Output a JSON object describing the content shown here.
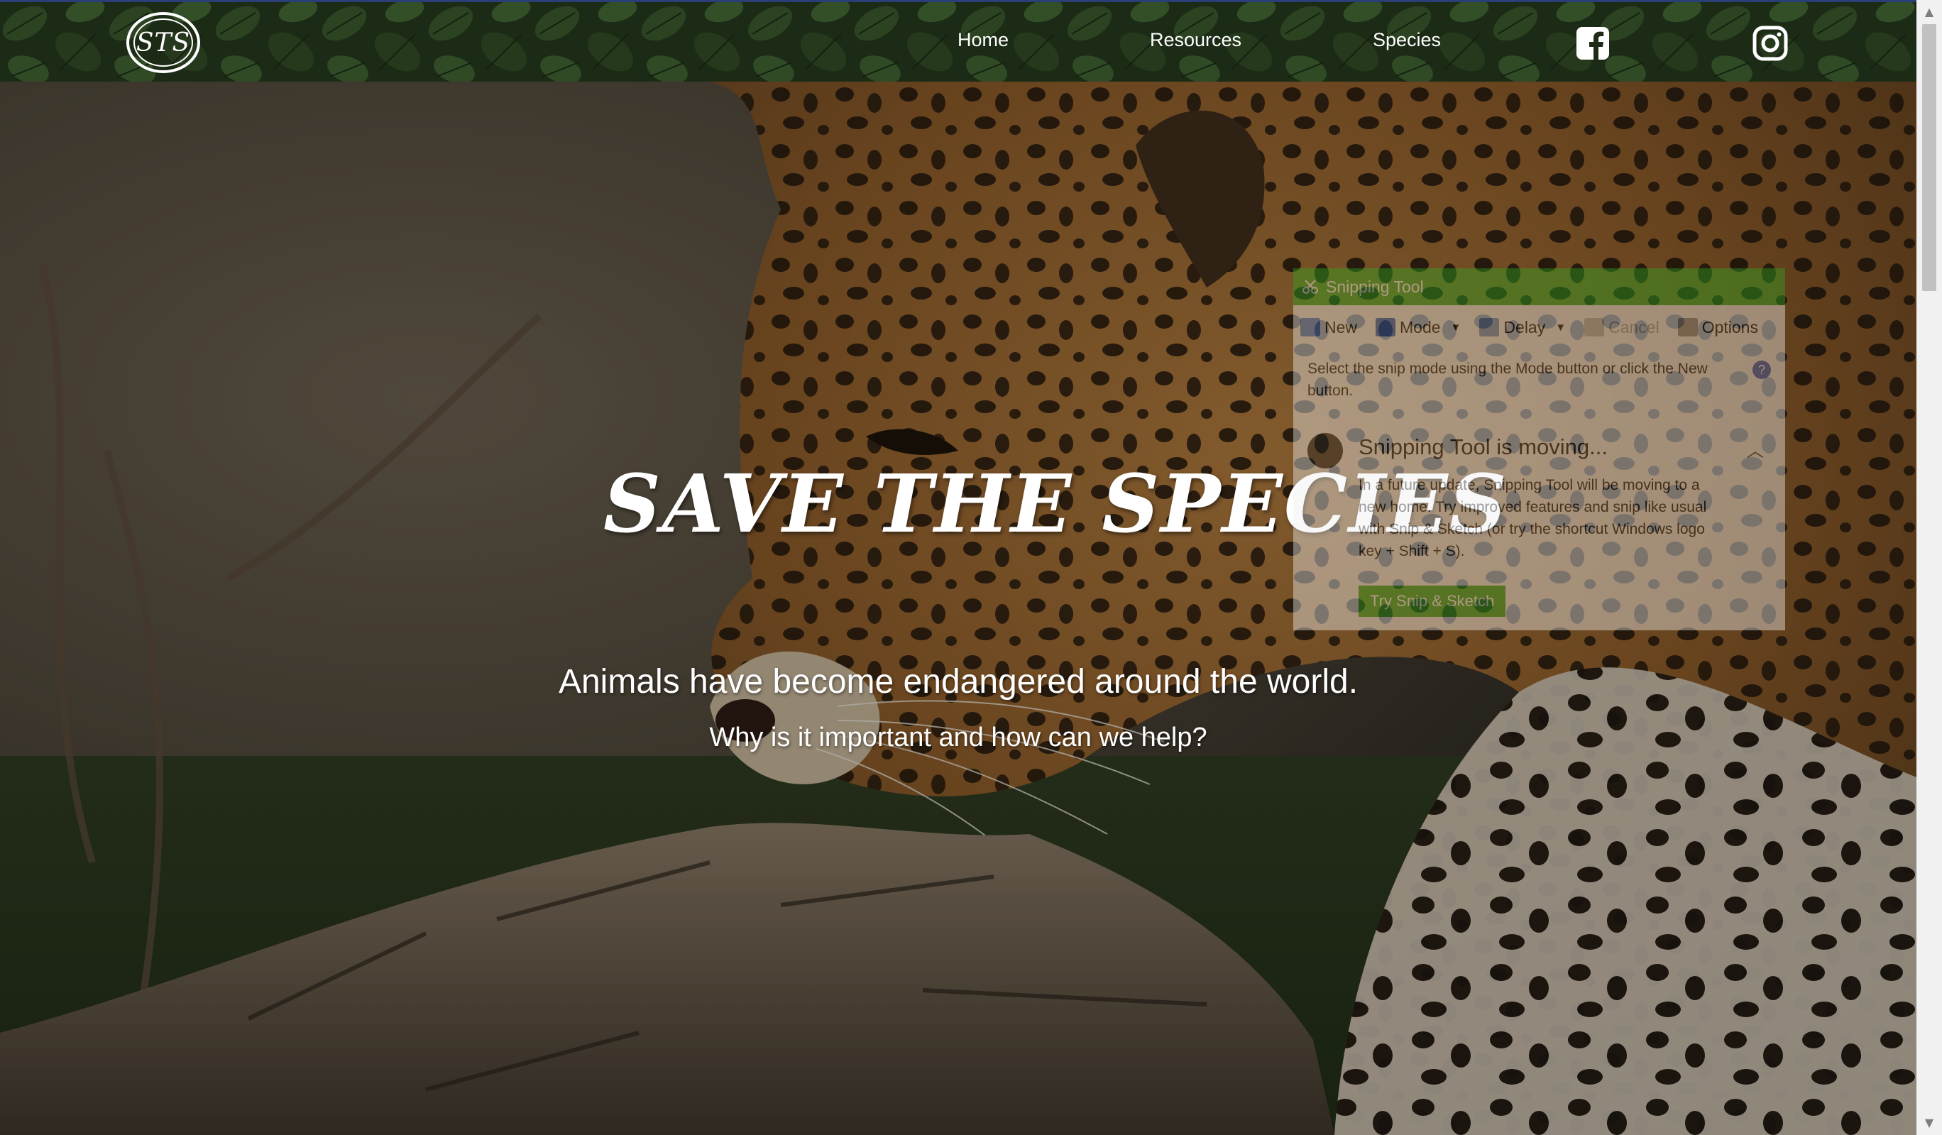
{
  "nav": {
    "logo_text": "STS",
    "links": [
      "Home",
      "Resources",
      "Species"
    ],
    "social": [
      "facebook-icon",
      "instagram-icon"
    ]
  },
  "hero": {
    "title": "SAVE THE SPECIES",
    "subtitle": "Animals have become endangered around the world.",
    "question": "Why is it important and how can we help?"
  },
  "snipping_tool": {
    "title": "Snipping Tool",
    "toolbar": {
      "new": "New",
      "mode": "Mode",
      "delay": "Delay",
      "cancel": "Cancel",
      "options": "Options"
    },
    "message": "Select the snip mode using the Mode button or click the New button.",
    "banner_title": "Snipping Tool is moving...",
    "banner_text": "In a future update, Snipping Tool will be moving to a new home. Try improved features and snip like usual with Snip & Sketch (or try the shortcut Windows logo key + Shift + S).",
    "button": "Try Snip & Sketch"
  },
  "colors": {
    "nav_bg": "#1d2c16",
    "snip_accent": "#2fa822"
  }
}
